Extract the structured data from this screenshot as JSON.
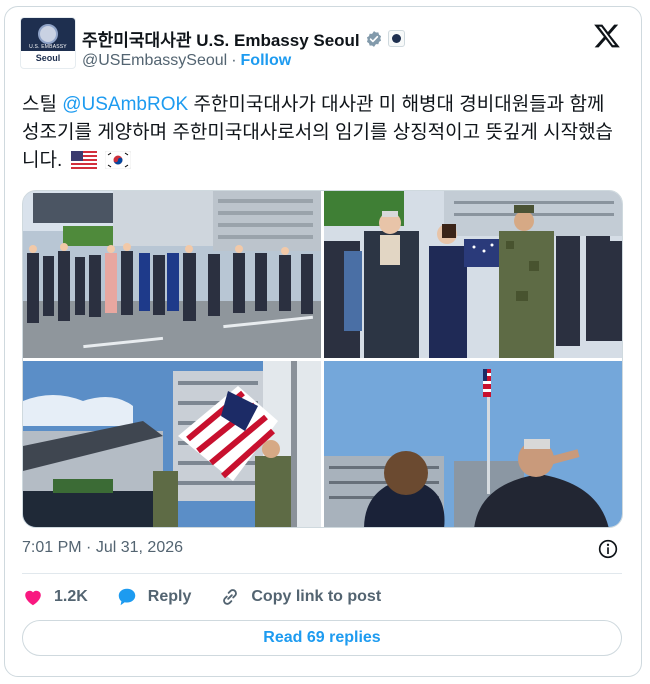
{
  "account": {
    "display_name": "주한미국대사관 U.S. Embassy Seoul",
    "handle": "@USEmbassySeoul",
    "separator": "·",
    "follow_label": "Follow",
    "avatar_band": "U.S. EMBASSY",
    "avatar_city": "Seoul"
  },
  "tweet": {
    "text_prefix": "스틸 ",
    "mention": "@USAmbROK",
    "text_body": " 주한미국대사가 대사관 미 해병대 경비대원들과 함께 성조기를 게양하며 주한미국대사로서의 임기를 상징적이고 뜻깊게 시작했습니다.",
    "emojis": [
      "us-flag",
      "kr-flag"
    ]
  },
  "media": {
    "photos": [
      "embassy-staff-ceremony",
      "flag-folding-handover",
      "marines-raising-flag",
      "saluting-flag"
    ]
  },
  "meta": {
    "time": "7:01 PM",
    "separator": "·",
    "date": "Jul 31, 2026"
  },
  "actions": {
    "likes": "1.2K",
    "reply_label": "Reply",
    "copy_label": "Copy link to post"
  },
  "read_replies_label": "Read 69 replies",
  "colors": {
    "accent": "#1d9bf0",
    "like": "#f91880",
    "text": "#0f1419",
    "muted": "#536471"
  }
}
